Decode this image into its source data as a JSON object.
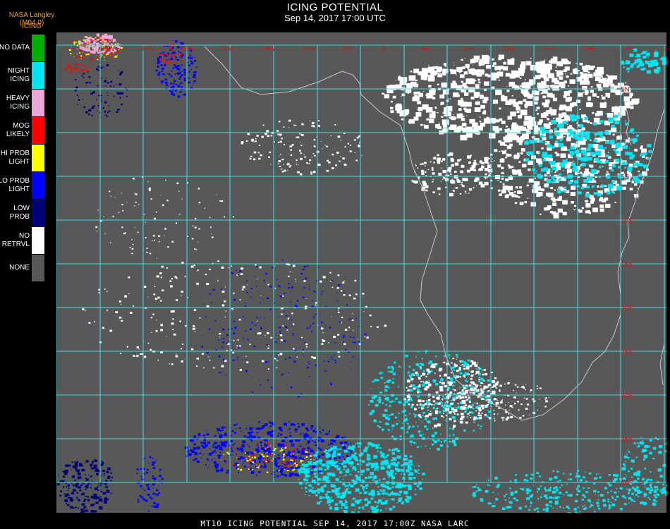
{
  "header": {
    "title": "ICING POTENTIAL",
    "timestamp": "Sep 14, 2017 17:00 UTC"
  },
  "provider": "NASA Langley (M04.0)",
  "product": "ICING",
  "legend": [
    {
      "label": "NO DATA",
      "color": "#00b000"
    },
    {
      "label": "NIGHT\nICING",
      "color": "#00e5f0"
    },
    {
      "label": "HEAVY\nICING",
      "color": "#e8a8d8"
    },
    {
      "label": "MOG\nLIKELY",
      "color": "#ff0000"
    },
    {
      "label": "HI PROB\nLIGHT",
      "color": "#ffff00"
    },
    {
      "label": "LO PROB\nLIGHT",
      "color": "#0000ff"
    },
    {
      "label": "LOW\nPROB",
      "color": "#00007a"
    },
    {
      "label": "NO\nRETRVL",
      "color": "#ffffff"
    },
    {
      "label": "NONE",
      "color": "#585858"
    }
  ],
  "map": {
    "background": "#585858",
    "gridColor": "#40e0e8",
    "labelColor": "#c02020",
    "topLabels": [
      "35W",
      "30W",
      "25W",
      "20W",
      "15W",
      "10W",
      "5W",
      "0",
      "5E",
      "10E",
      "15E",
      "20E",
      "25E",
      "30E",
      "35E"
    ],
    "rightLabels": [
      "5N",
      "0",
      "5S",
      "10S",
      "15S",
      "20S",
      "25S",
      "30S",
      "35S",
      "40S"
    ]
  },
  "footer": "MT10  ICING POTENTIAL   SEP 14, 2017 17:00Z   NASA LARC"
}
